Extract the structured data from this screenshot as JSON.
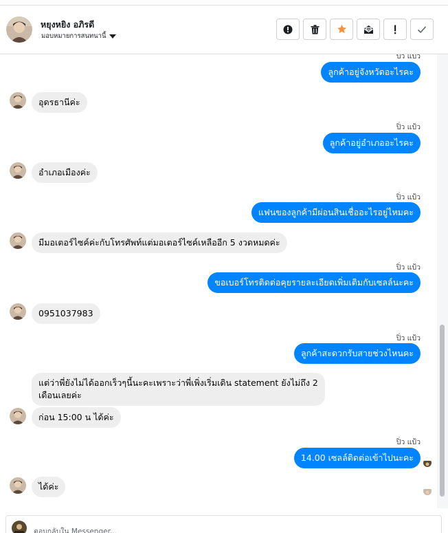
{
  "header": {
    "name": "หยุงหยิง อภิรดี",
    "assign_label": "มอบหมายการสนทนานี้"
  },
  "actions": [
    {
      "name": "report-icon",
      "color": "#1c1e21"
    },
    {
      "name": "trash-icon",
      "color": "#1c1e21"
    },
    {
      "name": "star-icon",
      "color": "#f7923b"
    },
    {
      "name": "mark-unread-icon",
      "color": "#1c1e21"
    },
    {
      "name": "exclamation-icon",
      "color": "#1c1e21"
    },
    {
      "name": "check-icon",
      "color": "#606770"
    }
  ],
  "messages": [
    {
      "dir": "out",
      "sender": "ปิ่ว แป้ว",
      "text": "ลูกค้าอยู่จังหวัดอะไรคะ"
    },
    {
      "dir": "in",
      "text": "อุดรธานีค่ะ"
    },
    {
      "dir": "out",
      "sender": "ปิ่ว แป้ว",
      "text": "ลูกค้าอยู่อำเภออะไรคะ"
    },
    {
      "dir": "in",
      "text": "อำเภอเมืองค่ะ"
    },
    {
      "dir": "out",
      "sender": "ปิ่ว แป้ว",
      "text": "แฟนของลูกค้ามีผ่อนสินเชื่ออะไรอยู่ไหมคะ"
    },
    {
      "dir": "in",
      "text": "มีมอเตอร์ไซค์ค่ะกับโทรศัพท์แต่มอเตอร์ไซค์เหลืออีก 5 งวดหมดค่ะ"
    },
    {
      "dir": "out",
      "sender": "ปิ่ว แป้ว",
      "text": "ขอเบอร์โทรติดต่อคุยรายละเอียดเพิ่มเติมกับเซลล์นะคะ"
    },
    {
      "dir": "in",
      "text": "0951037983"
    },
    {
      "dir": "out",
      "sender": "ปิ่ว แป้ว",
      "text": "ลูกค้าสะดวกรับสายช่วงไหนคะ"
    },
    {
      "dir": "in",
      "lines": [
        "แต่ว่าพี่ยังไม่ได้ออกเร็วๆนี้นะคะเพราะว่าพี่เพิ่งเริ่มเดิน statement ยังไม่ถึง 2",
        "เดือนเลยค่ะ"
      ]
    },
    {
      "dir": "in",
      "text": "ก่อน 15:00 น ได้ค่ะ"
    },
    {
      "dir": "out",
      "sender": "ปิ่ว แป้ว",
      "text": "14.00 เซลล์ติดต่อเข้าไปนะคะ"
    },
    {
      "dir": "in",
      "text": "ได้ค่ะ"
    }
  ],
  "reply": {
    "placeholder": "ตอบกลับใน Messenger..."
  },
  "colors": {
    "outgoing_bubble": "#0084ff",
    "incoming_bubble": "#eeeeee",
    "star": "#f7923b"
  }
}
